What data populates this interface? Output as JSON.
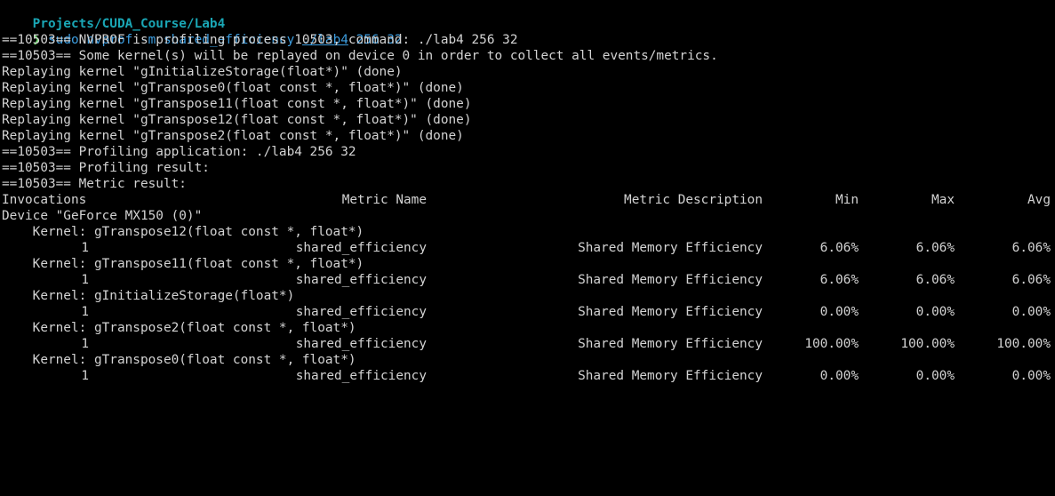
{
  "cwd": "Projects/CUDA_Course/Lab4",
  "prompt_symbol": "❯",
  "command": {
    "prefix": "sudo nvprof -m shared_efficiency",
    "path": "./lab4",
    "args": "256 32"
  },
  "output_lines": [
    "==10503== NVPROF is profiling process 10503, command: ./lab4 256 32",
    "==10503== Some kernel(s) will be replayed on device 0 in order to collect all events/metrics.",
    "Replaying kernel \"gInitializeStorage(float*)\" (done)",
    "Replaying kernel \"gTranspose0(float const *, float*)\" (done)",
    "Replaying kernel \"gTranspose11(float const *, float*)\" (done)",
    "Replaying kernel \"gTranspose12(float const *, float*)\" (done)",
    "Replaying kernel \"gTranspose2(float const *, float*)\" (done)",
    "==10503== Profiling application: ./lab4 256 32",
    "==10503== Profiling result:",
    "==10503== Metric result:"
  ],
  "table": {
    "headers": {
      "invocations": "Invocations",
      "metric_name": "Metric Name",
      "metric_description": "Metric Description",
      "min": "Min",
      "max": "Max",
      "avg": "Avg"
    },
    "device_line": "Device \"GeForce MX150 (0)\"",
    "kernels": [
      {
        "kernel_label": "    Kernel: gTranspose12(float const *, float*)",
        "invocations": "1",
        "metric_name": "shared_efficiency",
        "metric_description": "Shared Memory Efficiency",
        "min": "6.06%",
        "max": "6.06%",
        "avg": "6.06%"
      },
      {
        "kernel_label": "    Kernel: gTranspose11(float const *, float*)",
        "invocations": "1",
        "metric_name": "shared_efficiency",
        "metric_description": "Shared Memory Efficiency",
        "min": "6.06%",
        "max": "6.06%",
        "avg": "6.06%"
      },
      {
        "kernel_label": "    Kernel: gInitializeStorage(float*)",
        "invocations": "1",
        "metric_name": "shared_efficiency",
        "metric_description": "Shared Memory Efficiency",
        "min": "0.00%",
        "max": "0.00%",
        "avg": "0.00%"
      },
      {
        "kernel_label": "    Kernel: gTranspose2(float const *, float*)",
        "invocations": "1",
        "metric_name": "shared_efficiency",
        "metric_description": "Shared Memory Efficiency",
        "min": "100.00%",
        "max": "100.00%",
        "avg": "100.00%"
      },
      {
        "kernel_label": "    Kernel: gTranspose0(float const *, float*)",
        "invocations": "1",
        "metric_name": "shared_efficiency",
        "metric_description": "Shared Memory Efficiency",
        "min": "0.00%",
        "max": "0.00%",
        "avg": "0.00%"
      }
    ]
  }
}
